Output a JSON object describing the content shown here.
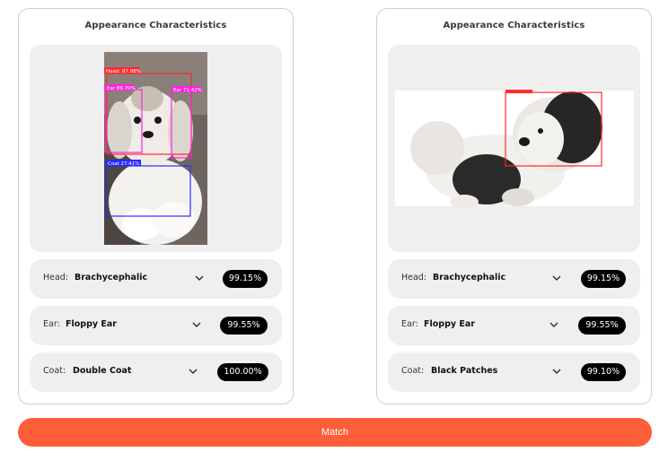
{
  "left_panel": {
    "title": "Appearance Characteristics",
    "detections": {
      "head": "Head: 87.88%",
      "ear_left": "Ear 89.70%",
      "ear_right": "Ear 71.42%",
      "coat": "Coat 27.41%"
    },
    "traits": [
      {
        "label": "Head:",
        "value": "Brachycephalic",
        "score": "99.15%"
      },
      {
        "label": "Ear:",
        "value": "Floppy Ear",
        "score": "99.55%"
      },
      {
        "label": "Coat:",
        "value": "Double Coat",
        "score": "100.00%"
      }
    ]
  },
  "right_panel": {
    "title": "Appearance Characteristics",
    "traits": [
      {
        "label": "Head:",
        "value": "Brachycephalic",
        "score": "99.15%"
      },
      {
        "label": "Ear:",
        "value": "Floppy Ear",
        "score": "99.55%"
      },
      {
        "label": "Coat:",
        "value": "Black Patches",
        "score": "99.10%"
      }
    ]
  },
  "match_button": "Match",
  "colors": {
    "accent": "#ff5e3a",
    "head_box": "#ff2a2a",
    "ear_box": "#ff22dd",
    "coat_box": "#2b2bff"
  }
}
